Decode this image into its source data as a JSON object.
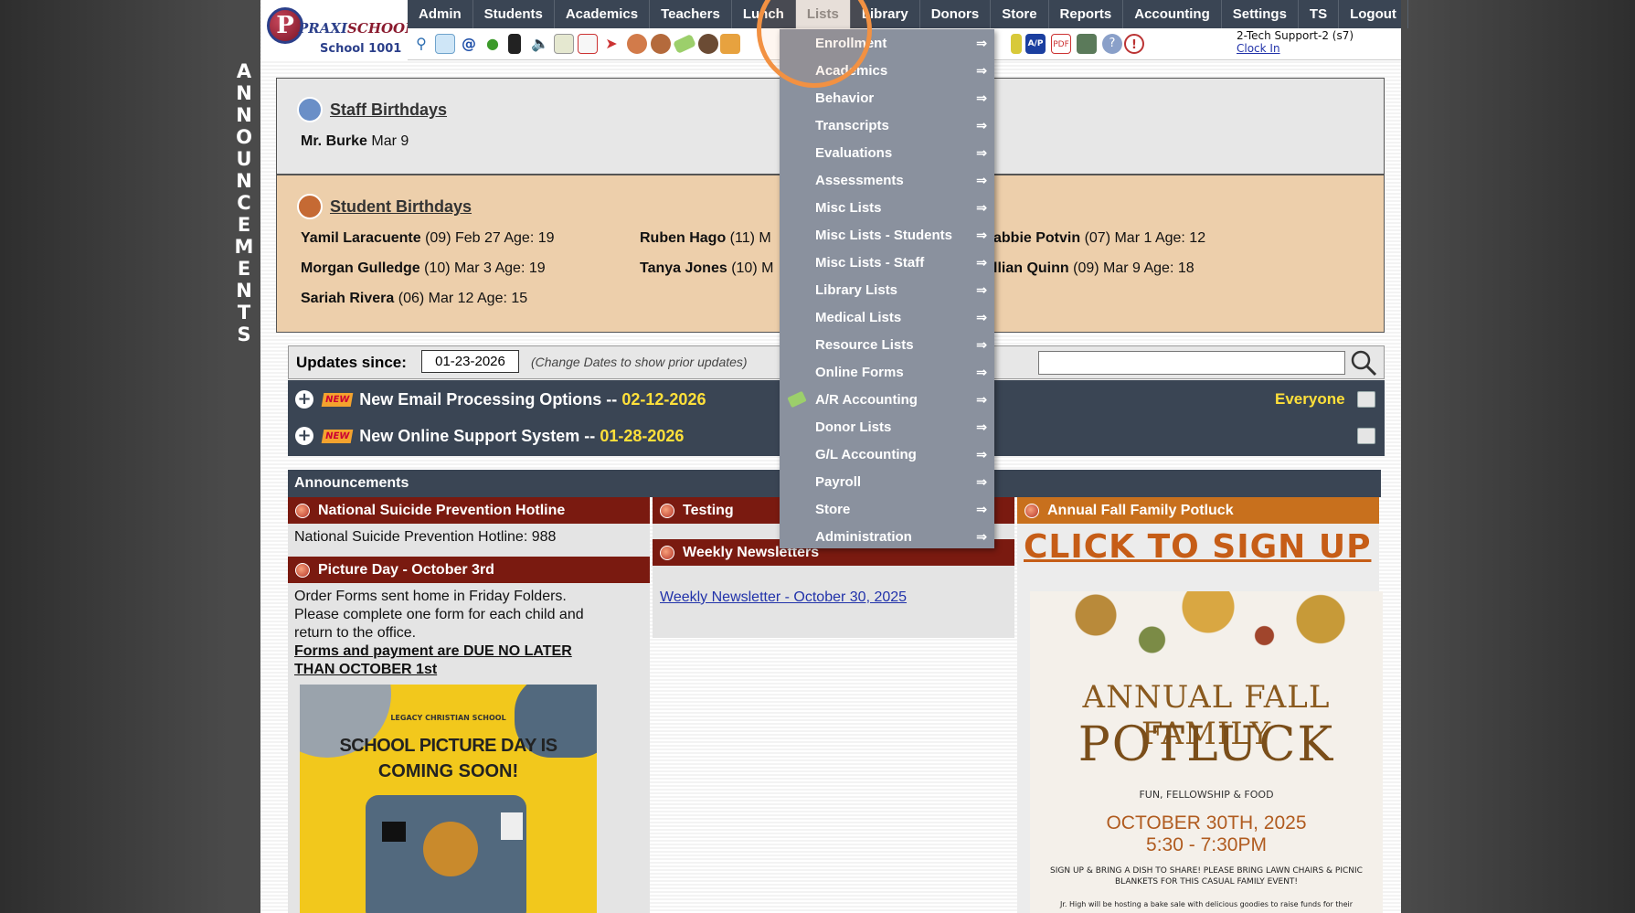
{
  "header": {
    "logo_text_praxi": "PRAXI",
    "logo_text_school": "SCHOOL",
    "school_name": "School 1001",
    "nav": [
      "Admin",
      "Students",
      "Academics",
      "Teachers",
      "Lunch",
      "Lists",
      "Library",
      "Donors",
      "Store",
      "Reports",
      "Accounting",
      "Settings",
      "TS",
      "Logout"
    ],
    "active_nav": "Lists",
    "user": "2-Tech Support-2 (s7)",
    "clock_in": "Clock In"
  },
  "sidebar_banner": [
    "A",
    "N",
    "N",
    "O",
    "U",
    "N",
    "C",
    "E",
    "M",
    "E",
    "N",
    "T",
    "S"
  ],
  "staff_birthdays": {
    "title": "Staff Birthdays",
    "entries": [
      {
        "name": "Mr. Burke",
        "date": "Mar 9"
      }
    ]
  },
  "student_birthdays": {
    "title": "Student Birthdays",
    "entries": [
      {
        "name": "Yamil Laracuente",
        "detail": "(09) Feb 27 Age: 19"
      },
      {
        "name": "Ruben Hago",
        "detail": "(11) M"
      },
      {
        "name": "abbie Potvin",
        "detail": "(07) Mar 1 Age: 12"
      },
      {
        "name": "Morgan Gulledge",
        "detail": "(10) Mar 3 Age: 19"
      },
      {
        "name": "Tanya Jones",
        "detail": "(10) M"
      },
      {
        "name": "llian Quinn",
        "detail": "(09) Mar 9 Age: 18"
      },
      {
        "name": "Sariah Rivera",
        "detail": "(06) Mar 12 Age: 15"
      }
    ]
  },
  "updates": {
    "label": "Updates since:",
    "date_value": "01-23-2026",
    "hint": "(Change Dates to show prior updates)",
    "search_value": "",
    "items": [
      {
        "badge": "NEW",
        "title": "New Email Processing Options --",
        "date": "02-12-2026",
        "audience": "Everyone"
      },
      {
        "badge": "NEW",
        "title": "New Online Support System --",
        "date": "01-28-2026",
        "audience": ""
      }
    ]
  },
  "announcements": {
    "header": "Announcements",
    "col1": [
      {
        "title": "National Suicide Prevention Hotline",
        "body": "National Suicide Prevention Hotline: 988"
      },
      {
        "title": "Picture Day - October 3rd",
        "body_lines": [
          "Order Forms sent home in Friday Folders.",
          "Please complete one form for each child and",
          "return to the office."
        ],
        "emphasis_lines": [
          "Forms and payment are DUE NO LATER",
          "THAN OCTOBER 1st"
        ]
      }
    ],
    "col2": [
      {
        "title": "Testing"
      },
      {
        "title": "Weekly Newsletters",
        "link": "Weekly Newsletter - October 30, 2025"
      }
    ],
    "col3": [
      {
        "title": "Annual Fall Family Potluck",
        "link": "CLICK TO SIGN UP"
      }
    ],
    "picture_flyer": {
      "school": "LEGACY CHRISTIAN SCHOOL",
      "headline_1": "SCHOOL PICTURE DAY IS",
      "headline_2": "COMING SOON!"
    },
    "potluck_flyer": {
      "headline_1": "ANNUAL FALL FAMILY",
      "headline_2": "POTLUCK",
      "tagline": "FUN, FELLOWSHIP & FOOD",
      "date": "OCTOBER 30TH, 2025",
      "time": "5:30 - 7:30PM",
      "note": "SIGN UP & BRING A DISH TO SHARE! PLEASE BRING LAWN CHAIRS & PICNIC BLANKETS FOR THIS CASUAL FAMILY EVENT!",
      "footnote": "Jr. High will be hosting a bake sale with delicious goodies to raise funds for their"
    }
  },
  "lists_menu": {
    "items": [
      "Enrollment",
      "Academics",
      "Behavior",
      "Transcripts",
      "Evaluations",
      "Assessments",
      "Misc Lists",
      "Misc Lists - Students",
      "Misc Lists - Staff",
      "Library Lists",
      "Medical Lists",
      "Resource Lists",
      "Online Forms",
      "A/R Accounting",
      "Donor Lists",
      "G/L Accounting",
      "Payroll",
      "Store",
      "Administration"
    ],
    "arrow": "⇒"
  },
  "colors": {
    "nav_bg": "#3a4554",
    "announcement_title_red": "#7a1a10",
    "announcement_title_orange": "#c8701d",
    "highlight_ring": "#f29142",
    "update_date": "#ffe03a"
  }
}
